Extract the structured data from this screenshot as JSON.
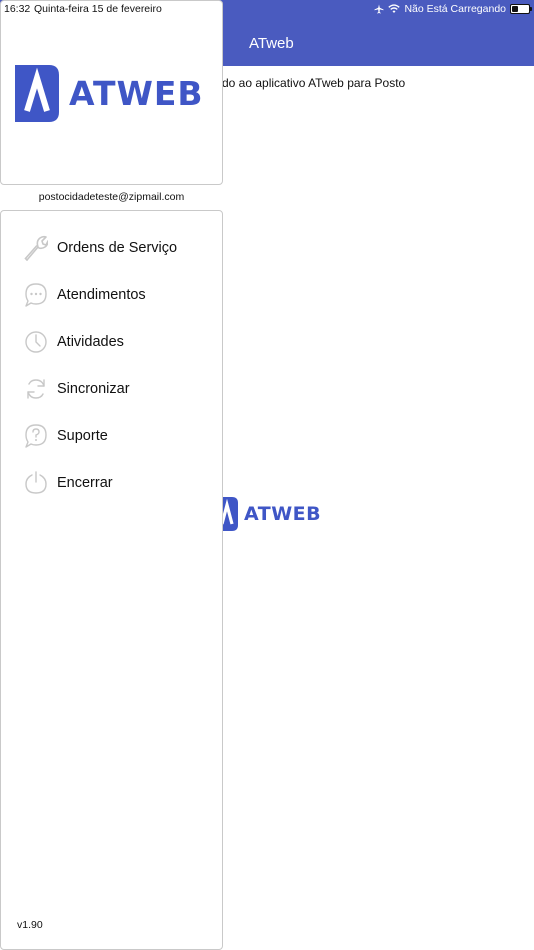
{
  "status_bar": {
    "time": "16:32",
    "date": "Quinta-feira 15 de fevereiro",
    "charging_status": "Não Está Carregando",
    "icons": [
      "airplane-icon",
      "wifi-icon",
      "battery-icon"
    ]
  },
  "main": {
    "title": "ATweb",
    "welcome_text": "do ao aplicativo ATweb para Posto",
    "logo_word": "ATWEB"
  },
  "drawer": {
    "logo_word": "ATWEB",
    "email": "postocidadeteste@zipmail.com",
    "items": [
      {
        "label": "Ordens de Serviço",
        "icon": "wrench-icon"
      },
      {
        "label": "Atendimentos",
        "icon": "chat-bubble-icon"
      },
      {
        "label": "Atividades",
        "icon": "clock-icon"
      },
      {
        "label": "Sincronizar",
        "icon": "sync-icon"
      },
      {
        "label": "Suporte",
        "icon": "help-icon"
      },
      {
        "label": "Encerrar",
        "icon": "power-icon"
      }
    ],
    "version": "v1.90"
  },
  "colors": {
    "header": "#4a5bbf",
    "brand": "#3f56c6",
    "icon_gray": "#c8c8c8"
  }
}
